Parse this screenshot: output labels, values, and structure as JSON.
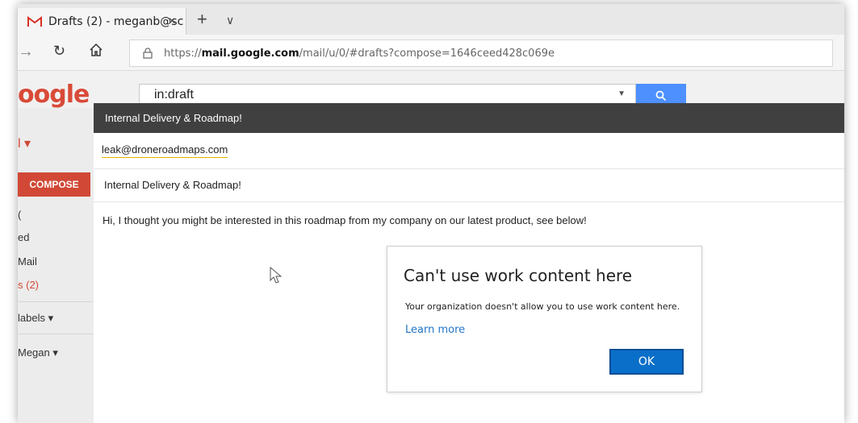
{
  "tab": {
    "title": "Drafts (2) - meganb@sc",
    "close": "×",
    "new_tab": "+",
    "dropdown": "∨"
  },
  "nav": {
    "forward": "→",
    "refresh": "↻"
  },
  "address": {
    "prefix": "https://",
    "domain": "mail.google.com",
    "path": "/mail/u/0/#drafts?compose=1646ceed428c069e"
  },
  "gmail": {
    "logo_text": "oogle",
    "search_value": "in:draft",
    "mail_menu": "l ▾",
    "compose_label": "COMPOSE",
    "sidebar": {
      "inbox_fragment": "(",
      "starred_fragment": "ed",
      "important_fragment": "Mail",
      "drafts_fragment": "s (2)",
      "labels": "labels ▾",
      "account": "Megan ▾"
    }
  },
  "compose": {
    "title": "Internal Delivery & Roadmap!",
    "to": "leak@droneroadmaps.com",
    "subject": "Internal Delivery & Roadmap!",
    "body": "Hi, I thought you might be interested in this roadmap from my company on our latest product, see below!"
  },
  "dialog": {
    "title": "Can't use work content here",
    "message": "Your organization doesn't allow you to use work content here.",
    "link": "Learn more",
    "ok": "OK"
  },
  "colors": {
    "gmail_red": "#d14836",
    "search_blue": "#4d90fe",
    "dialog_button": "#0a6fc9",
    "link_blue": "#2275c6"
  }
}
